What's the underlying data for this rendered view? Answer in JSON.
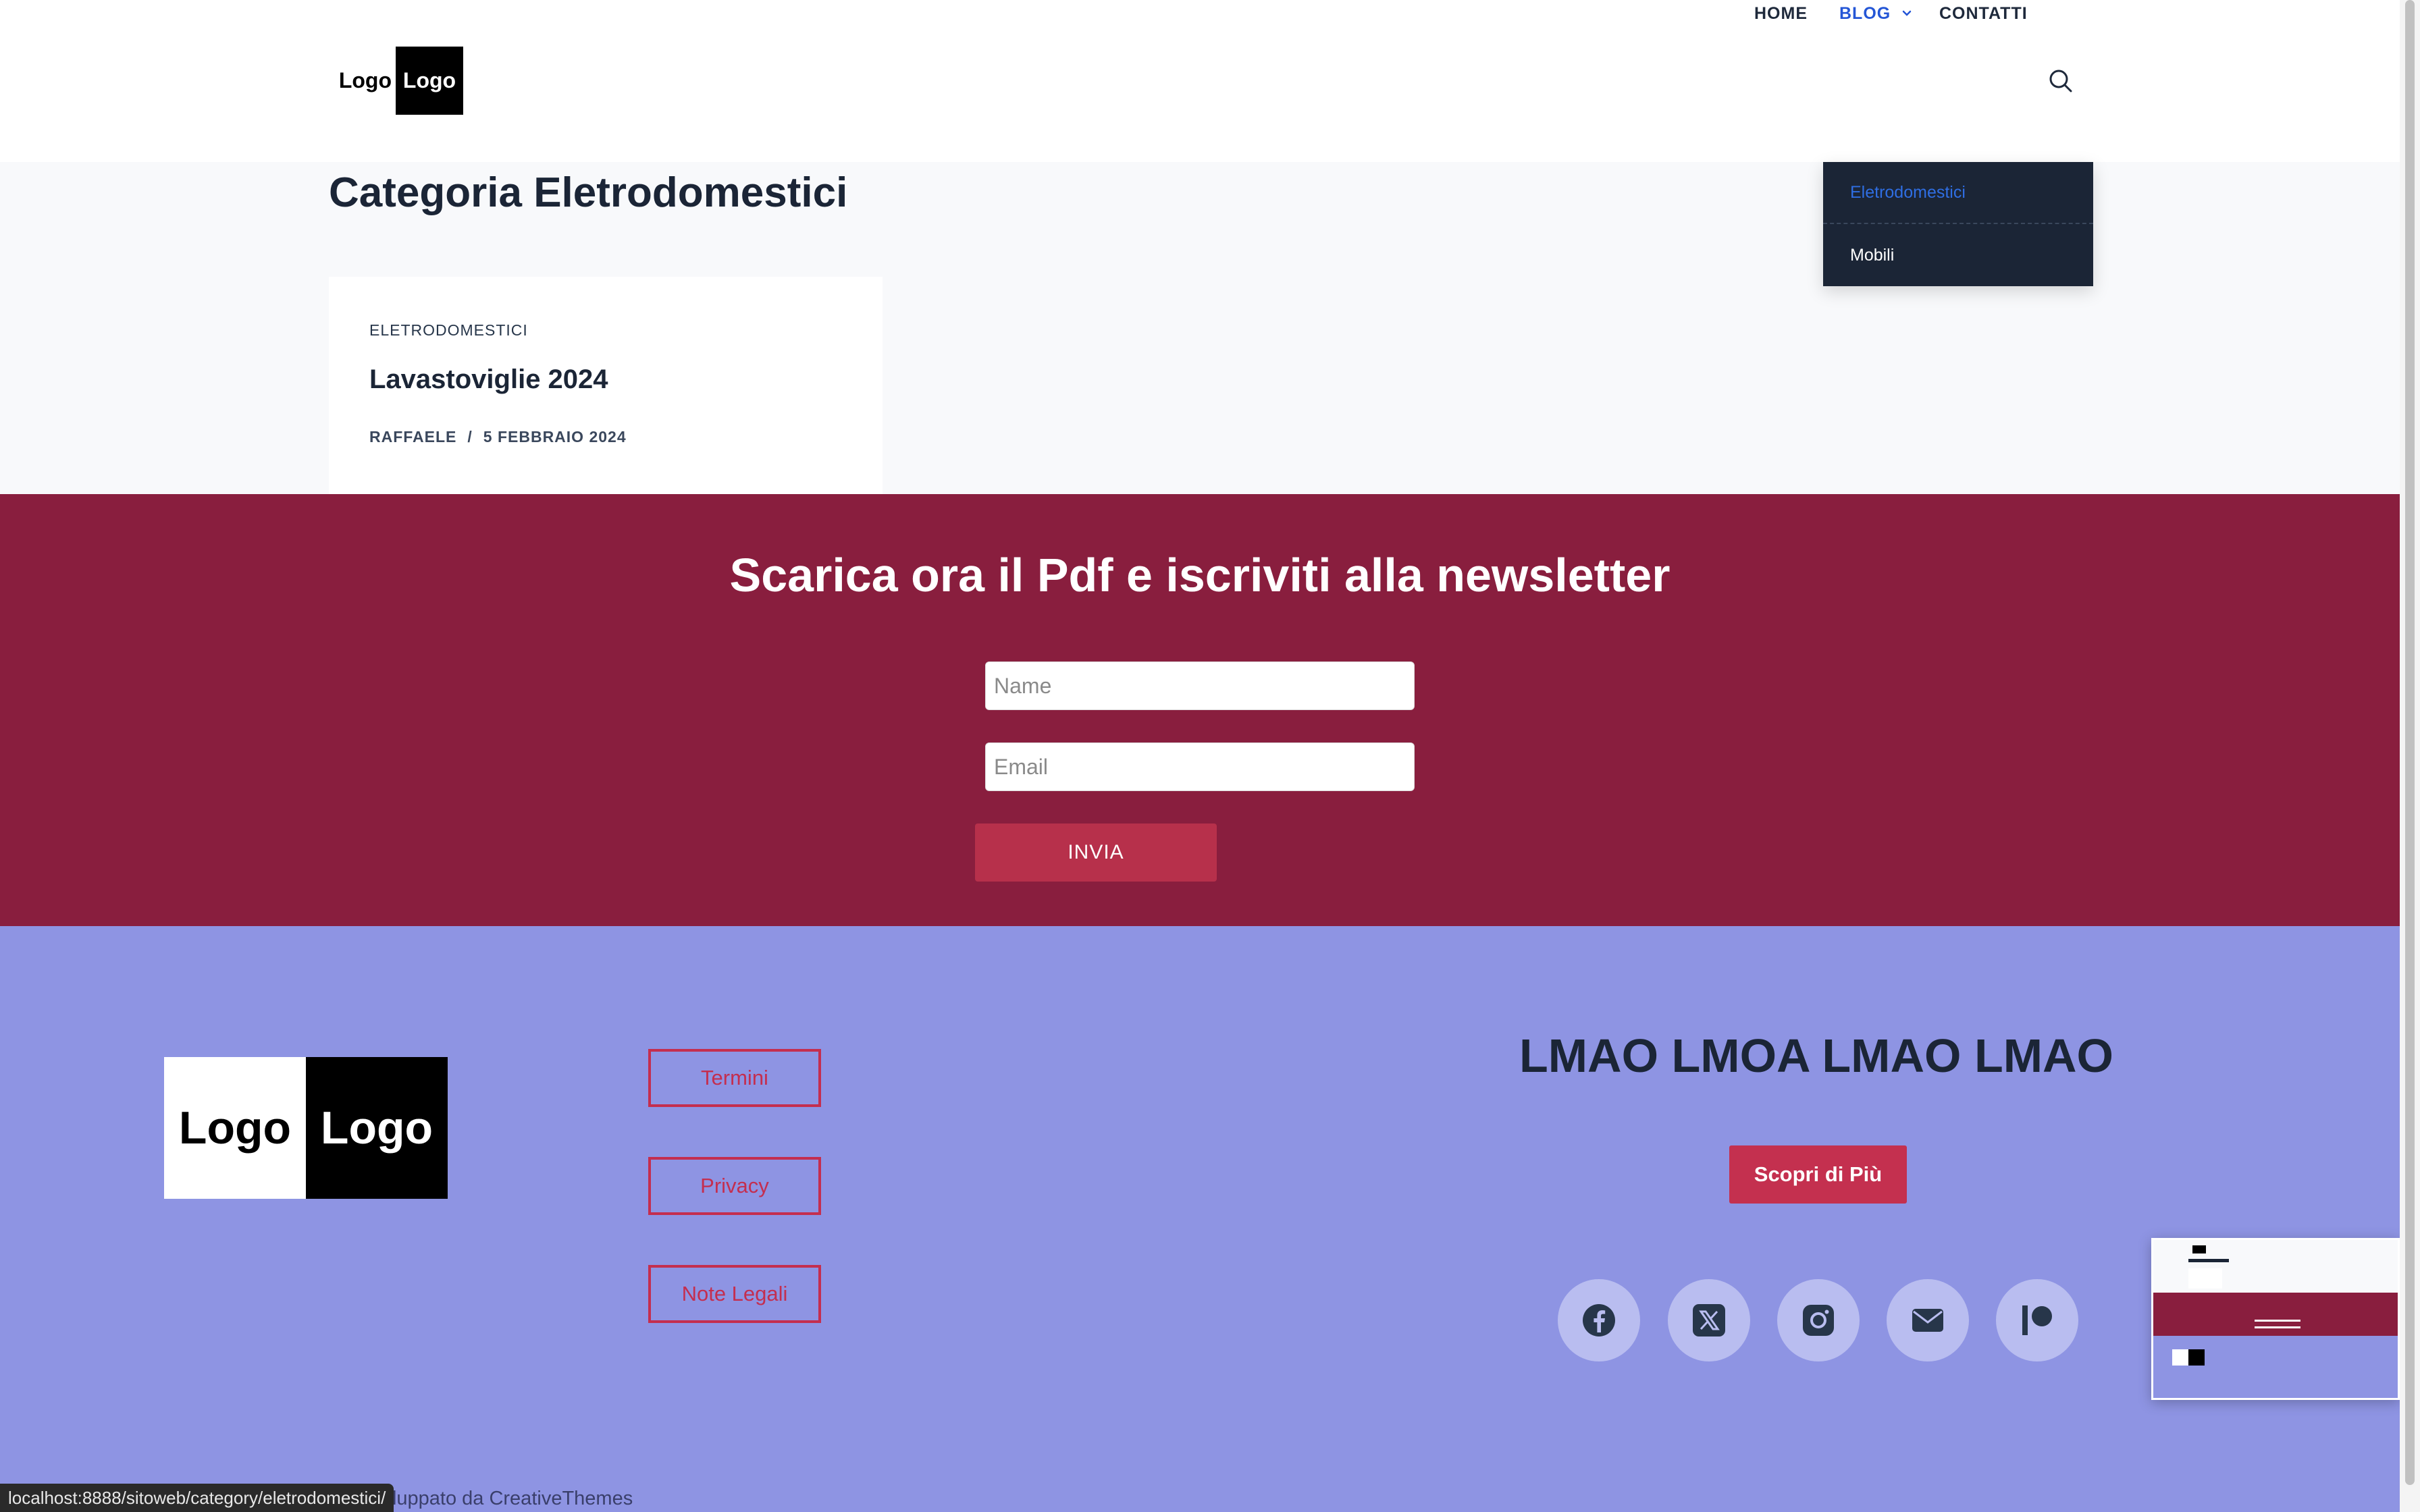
{
  "header": {
    "logo_left": "Logo",
    "logo_right": "Logo",
    "nav": [
      {
        "label": "HOME"
      },
      {
        "label": "BLOG"
      },
      {
        "label": "CONTATTI"
      }
    ],
    "blog_dropdown": [
      {
        "label": "Eletrodomestici",
        "active": true
      },
      {
        "label": "Mobili",
        "active": false
      }
    ]
  },
  "main": {
    "page_title": "Categoria Eletrodomestici",
    "post": {
      "category": "ELETRODOMESTICI",
      "title": "Lavastoviglie 2024",
      "author": "RAFFAELE",
      "separator": "/",
      "date": "5 FEBBRAIO 2024"
    }
  },
  "newsletter": {
    "title": "Scarica ora il Pdf e iscriviti alla newsletter",
    "name_placeholder": "Name",
    "email_placeholder": "Email",
    "submit_label": "INVIA"
  },
  "footer": {
    "logo_left": "Logo",
    "logo_right": "Logo",
    "links": [
      {
        "label": "Termini"
      },
      {
        "label": "Privacy"
      },
      {
        "label": "Note Legali"
      }
    ],
    "heading": "LMAO LMOA LMAO LMAO",
    "cta_label": "Scopri di Più",
    "social_icons": [
      "facebook-icon",
      "x-icon",
      "instagram-icon",
      "email-icon",
      "patreon-icon"
    ],
    "credits": "viluppato da CreativeThemes"
  },
  "statusbar": {
    "url": "localhost:8888/sitoweb/category/eletrodomestici/"
  },
  "colors": {
    "accent_blue": "#2456d6",
    "dark_navy": "#1b2536",
    "newsletter_bg": "#891e3e",
    "footer_bg": "#8e94e3",
    "button_red": "#b7304b"
  }
}
